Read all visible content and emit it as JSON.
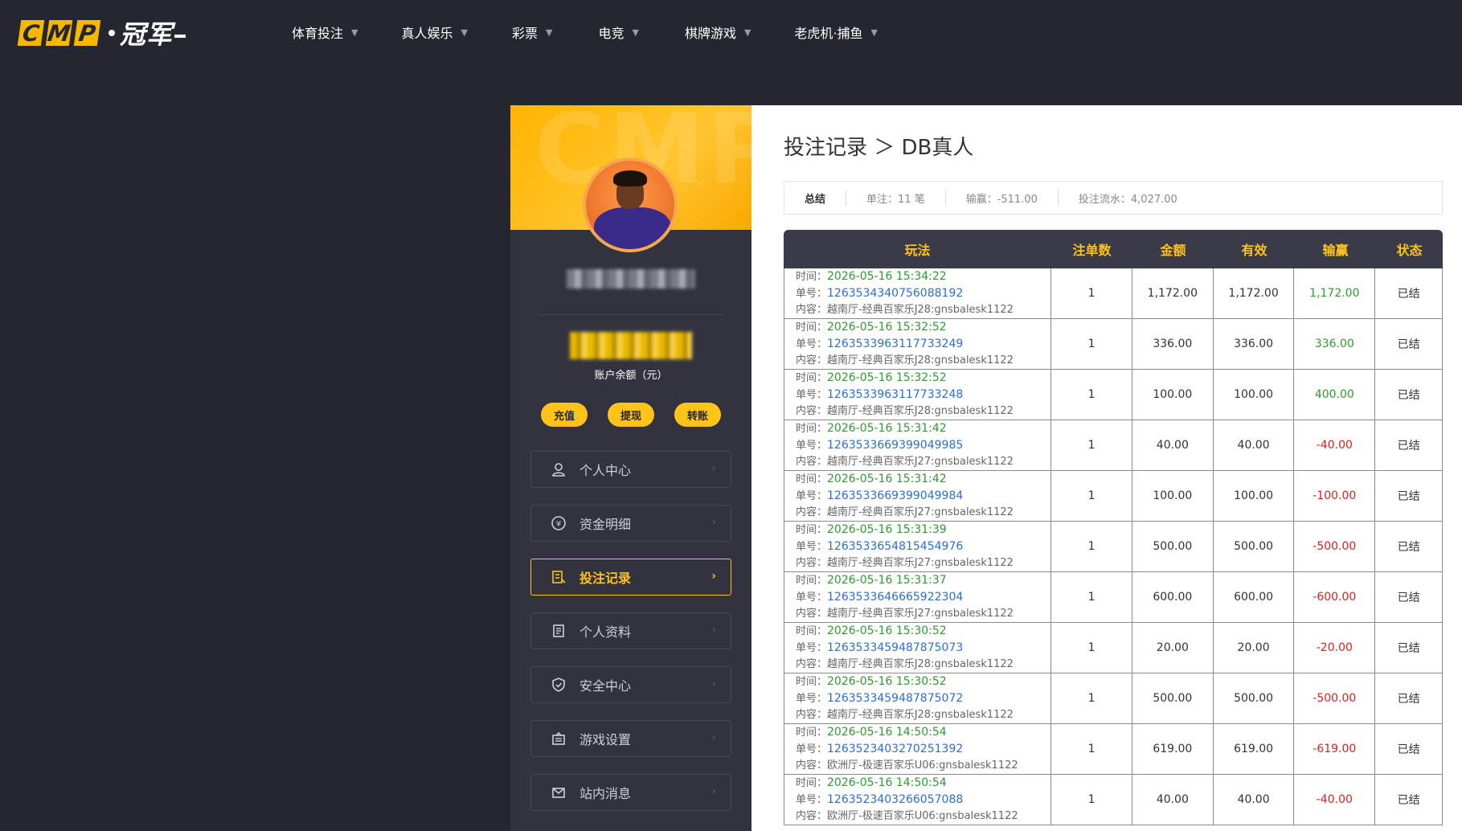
{
  "logo": {
    "letters": [
      "C",
      "M",
      "P"
    ],
    "cn": "冠军"
  },
  "nav": [
    {
      "label": "体育投注"
    },
    {
      "label": "真人娱乐"
    },
    {
      "label": "彩票"
    },
    {
      "label": "电竞"
    },
    {
      "label": "棋牌游戏"
    },
    {
      "label": "老虎机·捕鱼"
    }
  ],
  "sidebar": {
    "balance_label": "账户余额（元）",
    "actions": [
      "充值",
      "提现",
      "转账"
    ],
    "menu": [
      {
        "label": "个人中心",
        "icon": "user-icon"
      },
      {
        "label": "资金明细",
        "icon": "money-icon"
      },
      {
        "label": "投注记录",
        "icon": "bet-record-icon",
        "active": true
      },
      {
        "label": "个人资料",
        "icon": "profile-icon"
      },
      {
        "label": "安全中心",
        "icon": "shield-icon"
      },
      {
        "label": "游戏设置",
        "icon": "game-settings-icon"
      },
      {
        "label": "站内消息",
        "icon": "mail-icon"
      }
    ]
  },
  "main": {
    "title": "投注记录 ＞ DB真人",
    "summary": {
      "label": "总结",
      "bets": "单注：11 笔",
      "profit": "输赢：-511.00",
      "turnover": "投注流水：4,027.00"
    },
    "headers": [
      "玩法",
      "注单数",
      "金额",
      "有效",
      "输赢",
      "状态"
    ],
    "labels": {
      "time": "时间：",
      "order": "单号：",
      "content": "内容："
    },
    "rows": [
      {
        "time": "2026-05-16 15:34:22",
        "order": "1263534340756088192",
        "content": "越南厅-经典百家乐J28:gnsbalesk1122",
        "count": "1",
        "amount": "1,172.00",
        "valid": "1,172.00",
        "profit": "1,172.00",
        "status": "已结",
        "win": true
      },
      {
        "time": "2026-05-16 15:32:52",
        "order": "1263533963117733249",
        "content": "越南厅-经典百家乐J28:gnsbalesk1122",
        "count": "1",
        "amount": "336.00",
        "valid": "336.00",
        "profit": "336.00",
        "status": "已结",
        "win": true
      },
      {
        "time": "2026-05-16 15:32:52",
        "order": "1263533963117733248",
        "content": "越南厅-经典百家乐J28:gnsbalesk1122",
        "count": "1",
        "amount": "100.00",
        "valid": "100.00",
        "profit": "400.00",
        "status": "已结",
        "win": true
      },
      {
        "time": "2026-05-16 15:31:42",
        "order": "1263533669399049985",
        "content": "越南厅-经典百家乐J27:gnsbalesk1122",
        "count": "1",
        "amount": "40.00",
        "valid": "40.00",
        "profit": "-40.00",
        "status": "已结",
        "win": false
      },
      {
        "time": "2026-05-16 15:31:42",
        "order": "1263533669399049984",
        "content": "越南厅-经典百家乐J27:gnsbalesk1122",
        "count": "1",
        "amount": "100.00",
        "valid": "100.00",
        "profit": "-100.00",
        "status": "已结",
        "win": false
      },
      {
        "time": "2026-05-16 15:31:39",
        "order": "1263533654815454976",
        "content": "越南厅-经典百家乐J27:gnsbalesk1122",
        "count": "1",
        "amount": "500.00",
        "valid": "500.00",
        "profit": "-500.00",
        "status": "已结",
        "win": false
      },
      {
        "time": "2026-05-16 15:31:37",
        "order": "1263533646665922304",
        "content": "越南厅-经典百家乐J27:gnsbalesk1122",
        "count": "1",
        "amount": "600.00",
        "valid": "600.00",
        "profit": "-600.00",
        "status": "已结",
        "win": false
      },
      {
        "time": "2026-05-16 15:30:52",
        "order": "1263533459487875073",
        "content": "越南厅-经典百家乐J28:gnsbalesk1122",
        "count": "1",
        "amount": "20.00",
        "valid": "20.00",
        "profit": "-20.00",
        "status": "已结",
        "win": false
      },
      {
        "time": "2026-05-16 15:30:52",
        "order": "1263533459487875072",
        "content": "越南厅-经典百家乐J28:gnsbalesk1122",
        "count": "1",
        "amount": "500.00",
        "valid": "500.00",
        "profit": "-500.00",
        "status": "已结",
        "win": false
      },
      {
        "time": "2026-05-16 14:50:54",
        "order": "1263523403270251392",
        "content": "欧洲厅-极速百家乐U06:gnsbalesk1122",
        "count": "1",
        "amount": "619.00",
        "valid": "619.00",
        "profit": "-619.00",
        "status": "已结",
        "win": false
      },
      {
        "time": "2026-05-16 14:50:54",
        "order": "1263523403266057088",
        "content": "欧洲厅-极速百家乐U06:gnsbalesk1122",
        "count": "1",
        "amount": "40.00",
        "valid": "40.00",
        "profit": "-40.00",
        "status": "已结",
        "win": false
      }
    ]
  },
  "colors": {
    "accent": "#ffc31a",
    "win": "#2e9b2e",
    "lose": "#e02020",
    "link": "#2b6fd6",
    "bg": "#262631"
  }
}
